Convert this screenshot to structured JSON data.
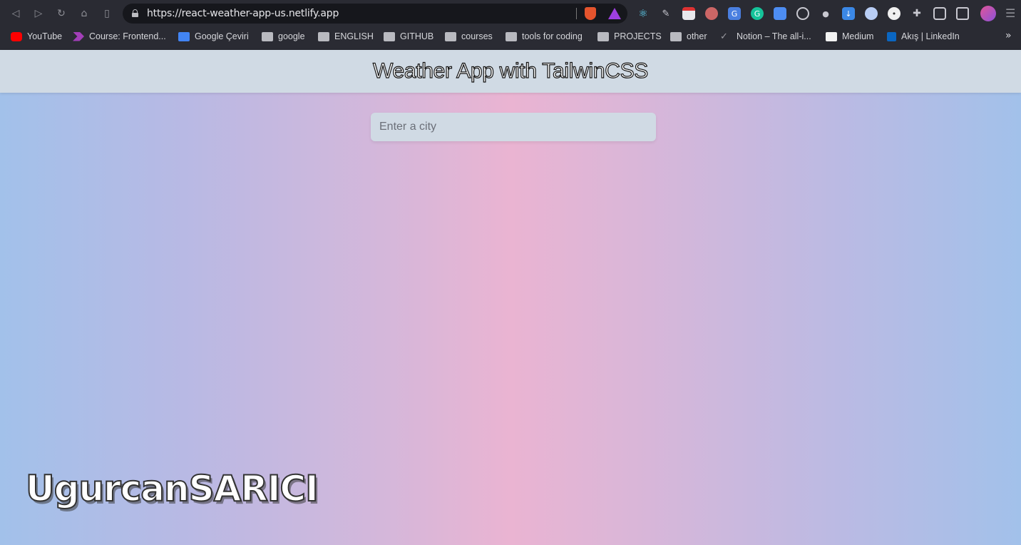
{
  "browser": {
    "url": "https://react-weather-app-us.netlify.app",
    "bookmarks": [
      {
        "label": "YouTube",
        "icon": "youtube-icon",
        "color": "#ff0000"
      },
      {
        "label": "Course: Frontend...",
        "icon": "course-icon",
        "color": "#a23fb8"
      },
      {
        "label": "Google Çeviri",
        "icon": "google-translate-icon",
        "color": "#4285f4"
      },
      {
        "label": "google",
        "icon": "folder-icon"
      },
      {
        "label": "ENGLISH",
        "icon": "folder-icon"
      },
      {
        "label": "GITHUB",
        "icon": "folder-icon"
      },
      {
        "label": "courses",
        "icon": "folder-icon"
      },
      {
        "label": "tools for coding",
        "icon": "folder-icon"
      },
      {
        "label": "PROJECTS",
        "icon": "folder-icon"
      },
      {
        "label": "other",
        "icon": "folder-icon"
      },
      {
        "label": "Notion – The all-i...",
        "icon": "notion-icon"
      },
      {
        "label": "Medium",
        "icon": "medium-icon"
      },
      {
        "label": "Akış | LinkedIn",
        "icon": "linkedin-icon",
        "color": "#0a66c2"
      }
    ],
    "more_label": "»"
  },
  "app": {
    "title": "Weather App with TailwinCSS",
    "search": {
      "placeholder": "Enter a city",
      "value": ""
    }
  },
  "watermark": "UgurcanSARICI",
  "colors": {
    "header_bg": "#d0dae4",
    "gradient_edge": "#a2c1ea",
    "gradient_center": "#eab4d2"
  }
}
